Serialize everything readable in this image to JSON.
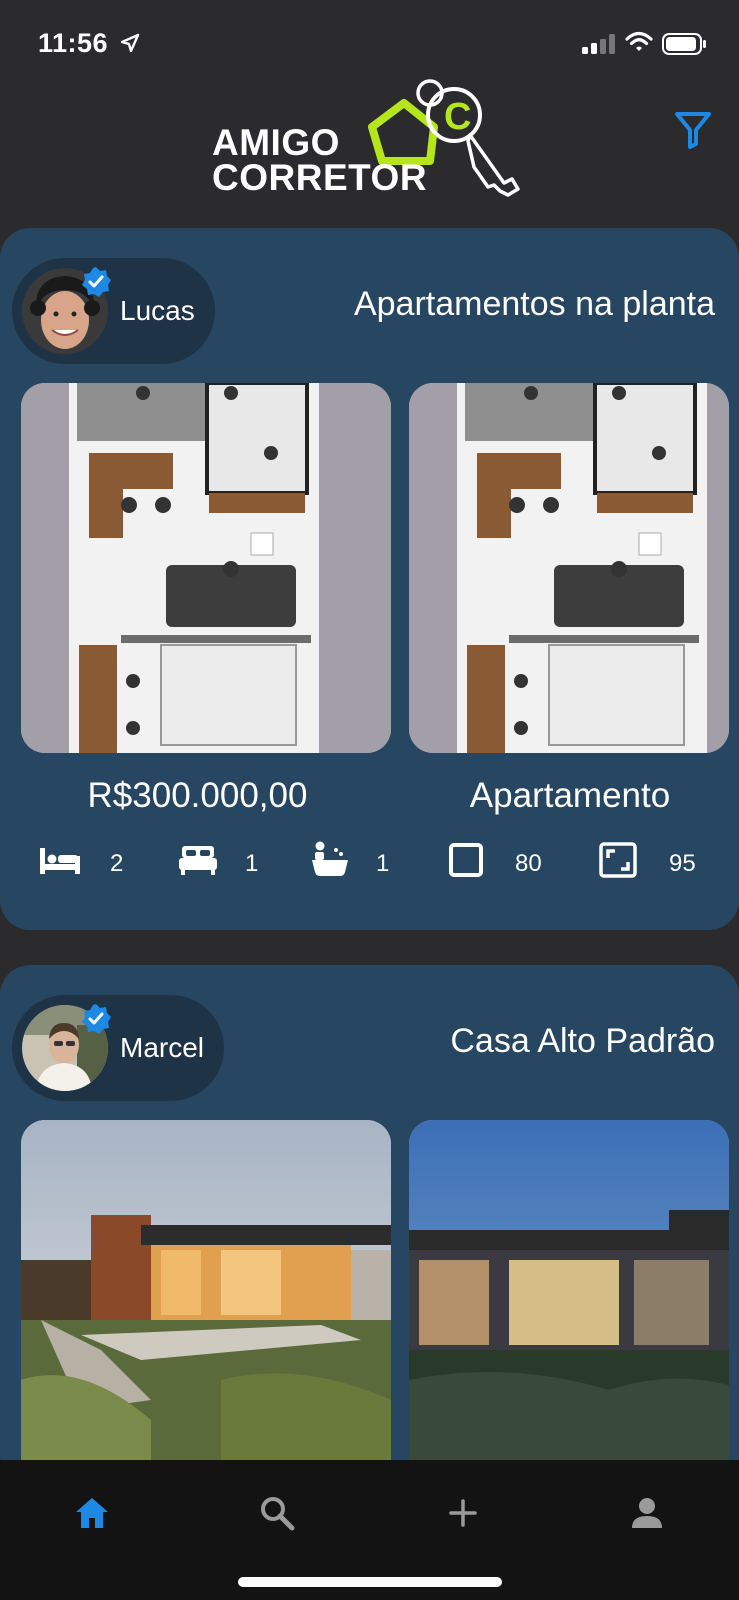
{
  "status_bar": {
    "time": "11:56"
  },
  "header": {
    "logo_line1": "AMIGO",
    "logo_line2": "CORRETOR",
    "logo_mark": "C",
    "filter_icon": "filter-icon"
  },
  "listings": [
    {
      "agent": "Lucas",
      "title": "Apartamentos na planta",
      "price": "R$300.000,00",
      "property_type": "Apartamento",
      "features": {
        "bedrooms": "2",
        "beds": "1",
        "bathrooms": "1",
        "area": "80",
        "total_area": "95"
      }
    },
    {
      "agent": "Marcel",
      "title": "Casa Alto Padrão"
    }
  ],
  "nav": {
    "items": [
      "home-icon",
      "search-icon",
      "add-icon",
      "profile-icon"
    ],
    "active": "home"
  },
  "colors": {
    "accent": "#1e88e5",
    "card": "#264662",
    "background": "#2b2b2d",
    "logo_green": "#b5e61d"
  }
}
